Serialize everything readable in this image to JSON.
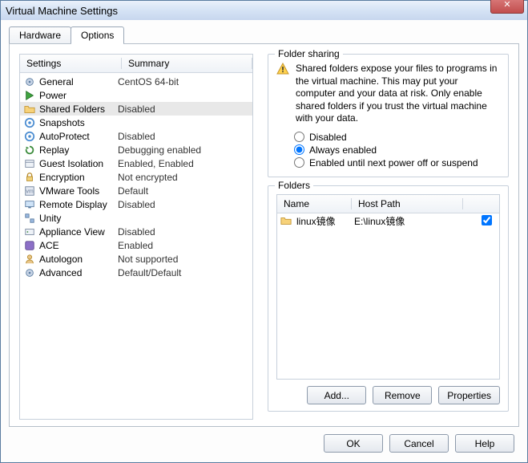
{
  "window": {
    "title": "Virtual Machine Settings"
  },
  "tabs": {
    "hardware": "Hardware",
    "options": "Options",
    "active": "Options"
  },
  "list": {
    "header": {
      "settings": "Settings",
      "summary": "Summary"
    },
    "items": [
      {
        "label": "General",
        "summary": "CentOS 64-bit",
        "icon": "gear"
      },
      {
        "label": "Power",
        "summary": "",
        "icon": "play"
      },
      {
        "label": "Shared Folders",
        "summary": "Disabled",
        "icon": "folder",
        "selected": true
      },
      {
        "label": "Snapshots",
        "summary": "",
        "icon": "snapshot"
      },
      {
        "label": "AutoProtect",
        "summary": "Disabled",
        "icon": "snapshot"
      },
      {
        "label": "Replay",
        "summary": "Debugging enabled",
        "icon": "replay"
      },
      {
        "label": "Guest Isolation",
        "summary": "Enabled, Enabled",
        "icon": "isolation"
      },
      {
        "label": "Encryption",
        "summary": "Not encrypted",
        "icon": "lock"
      },
      {
        "label": "VMware Tools",
        "summary": "Default",
        "icon": "tools"
      },
      {
        "label": "Remote Display",
        "summary": "Disabled",
        "icon": "display"
      },
      {
        "label": "Unity",
        "summary": "",
        "icon": "unity"
      },
      {
        "label": "Appliance View",
        "summary": "Disabled",
        "icon": "appliance"
      },
      {
        "label": "ACE",
        "summary": "Enabled",
        "icon": "ace"
      },
      {
        "label": "Autologon",
        "summary": "Not supported",
        "icon": "user"
      },
      {
        "label": "Advanced",
        "summary": "Default/Default",
        "icon": "gear"
      }
    ]
  },
  "sharing": {
    "legend": "Folder sharing",
    "warning": "Shared folders expose your files to programs in the virtual machine. This may put your computer and your data at risk. Only enable shared folders if you trust the virtual machine with your data.",
    "options": {
      "disabled": "Disabled",
      "always": "Always enabled",
      "until": "Enabled until next power off or suspend"
    },
    "selected": "always"
  },
  "folders": {
    "legend": "Folders",
    "header": {
      "name": "Name",
      "path": "Host Path"
    },
    "rows": [
      {
        "name": "linux镜像",
        "path": "E:\\linux镜像",
        "checked": true
      }
    ],
    "buttons": {
      "add": "Add...",
      "remove": "Remove",
      "properties": "Properties"
    }
  },
  "buttons": {
    "ok": "OK",
    "cancel": "Cancel",
    "help": "Help"
  }
}
